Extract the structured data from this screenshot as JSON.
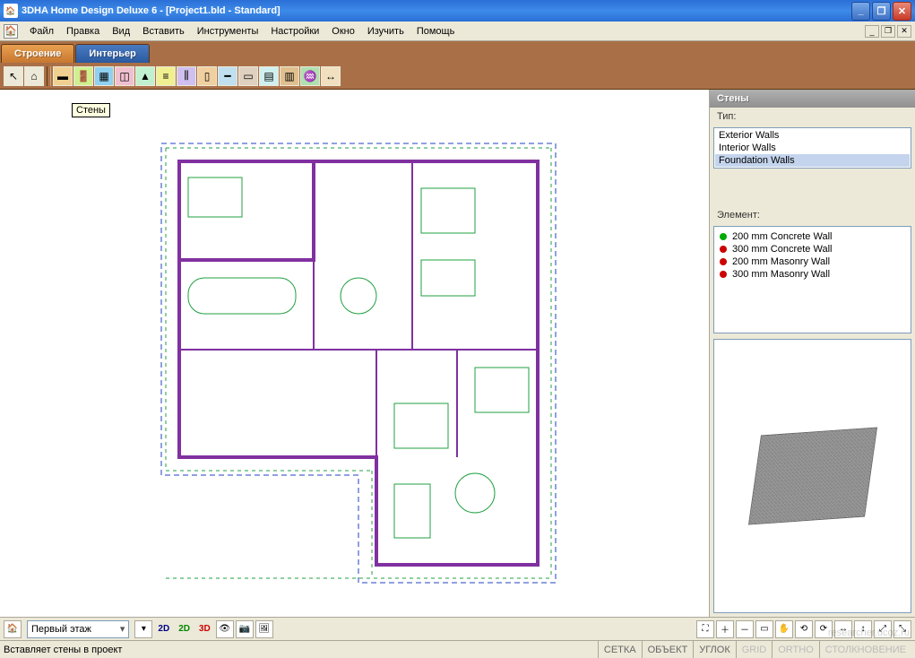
{
  "window": {
    "title": "3DHA Home Design Deluxe 6 - [Project1.bld - Standard]"
  },
  "menu": {
    "items": [
      "Файл",
      "Правка",
      "Вид",
      "Вставить",
      "Инструменты",
      "Настройки",
      "Окно",
      "Изучить",
      "Помощь"
    ]
  },
  "tabs": {
    "active": "Строение",
    "items": [
      "Строение",
      "Интерьер"
    ]
  },
  "toolbar": {
    "icons": [
      "arrow",
      "site",
      "wall",
      "door",
      "window",
      "roof",
      "stairs",
      "railing",
      "column",
      "beam",
      "slab",
      "ceiling",
      "deck",
      "terrain",
      "dimension",
      "text"
    ]
  },
  "canvas": {
    "tooltip": "Стены"
  },
  "sidebar": {
    "title": "Стены",
    "type_label": "Тип:",
    "types": [
      "Exterior Walls",
      "Interior Walls",
      "Foundation Walls"
    ],
    "selected_type_index": 2,
    "element_label": "Элемент:",
    "elements": [
      {
        "dot": "#0a0",
        "label": "200 mm Concrete Wall"
      },
      {
        "dot": "#c00",
        "label": "300 mm Concrete Wall"
      },
      {
        "dot": "#c00",
        "label": "200 mm Masonry Wall"
      },
      {
        "dot": "#c00",
        "label": "300 mm Masonry Wall"
      }
    ]
  },
  "bottombar": {
    "floor": "Первый этаж",
    "views": {
      "2d": "2D",
      "2d_color": "2D",
      "3d": "3D"
    }
  },
  "statusbar": {
    "hint": "Вставляет стены в проект",
    "cells": [
      "СЕТКА",
      "ОБЪЕКТ",
      "УГЛОК",
      "GRID",
      "ORTHO",
      "СТОЛКНОВЕНИЕ"
    ]
  },
  "watermark": "researcher.ucoz.ru"
}
